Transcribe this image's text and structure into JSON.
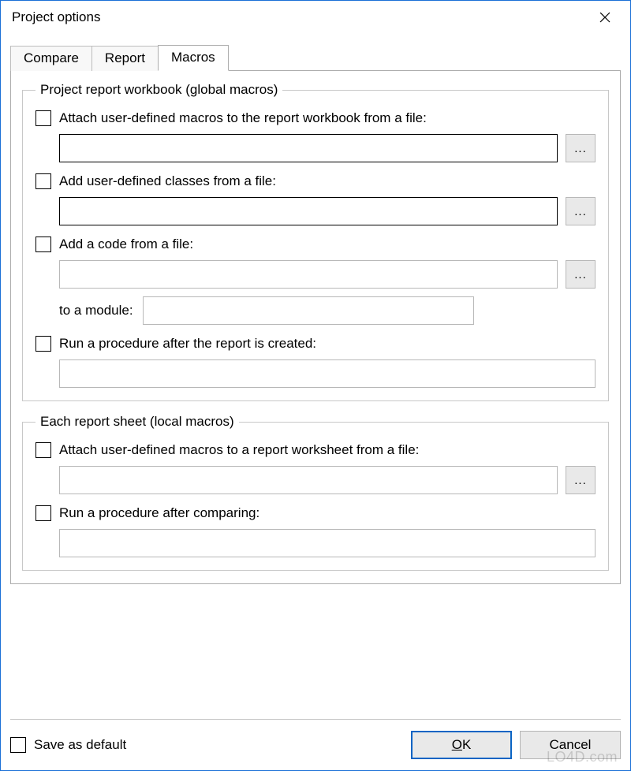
{
  "window": {
    "title": "Project options"
  },
  "tabs": {
    "compare": "Compare",
    "report": "Report",
    "macros": "Macros",
    "active": "macros"
  },
  "group1": {
    "legend": "Project report workbook (global macros)",
    "attach_macros_label": "Attach user-defined macros to the report workbook from a file:",
    "attach_macros_value": "",
    "add_classes_label": "Add user-defined classes from a file:",
    "add_classes_value": "",
    "add_code_label": "Add a code from a file:",
    "add_code_value": "",
    "to_module_label": "to a module:",
    "to_module_value": "",
    "run_proc_label": "Run a procedure after the report is created:",
    "run_proc_value": ""
  },
  "group2": {
    "legend": "Each report sheet (local macros)",
    "attach_macros_label": "Attach user-defined macros to a report worksheet from a file:",
    "attach_macros_value": "",
    "run_proc_label": "Run a procedure after comparing:",
    "run_proc_value": ""
  },
  "footer": {
    "save_default_label": "Save as default",
    "ok_prefix": "O",
    "ok_suffix": "K",
    "cancel": "Cancel"
  },
  "browse_label": "...",
  "watermark": "LO4D.com"
}
